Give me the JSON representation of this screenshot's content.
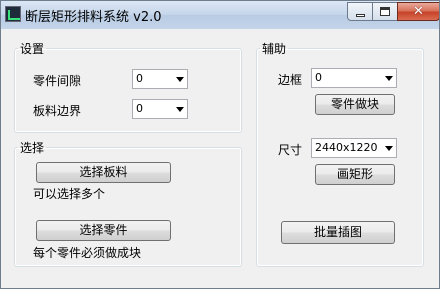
{
  "window": {
    "title": "断层矩形排料系统 v2.0"
  },
  "settings": {
    "title": "设置",
    "part_gap": {
      "label": "零件间隙",
      "value": "0"
    },
    "sheet_margin": {
      "label": "板料边界",
      "value": "0"
    }
  },
  "select": {
    "title": "选择",
    "choose_sheet_button": "选择板料",
    "sheet_hint": "可以选择多个",
    "choose_part_button": "选择零件",
    "part_hint": "每个零件必须做成块"
  },
  "aux": {
    "title": "辅助",
    "border": {
      "label": "边框",
      "value": "0"
    },
    "block_button": "零件做块",
    "size": {
      "label": "尺寸",
      "value": "2440x1220"
    },
    "draw_rect_button": "画矩形",
    "batch_insert_button": "批量插图"
  }
}
